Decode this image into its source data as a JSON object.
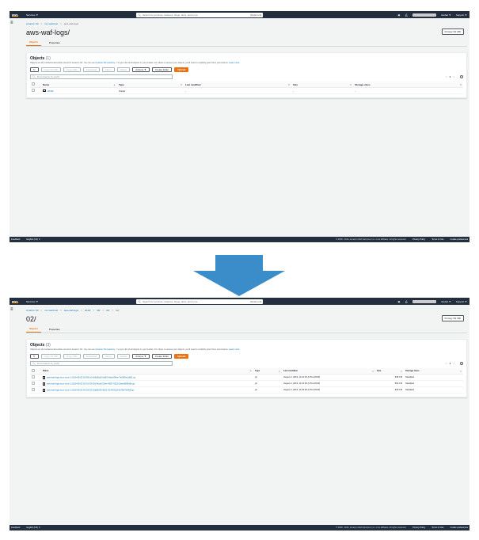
{
  "topbar": {
    "logo": "aws",
    "services": "Services ▼",
    "search_placeholder": "Search for services, features, blogs, docs, and more",
    "search_shortcut": "[Option+S]",
    "region": "Global ▼",
    "support": "Support ▼"
  },
  "footer": {
    "feedback": "Feedback",
    "language": "English (US) ▼",
    "copyright": "© 2008 - 2021, Amazon Web Services, Inc. or its affiliates. All rights reserved.",
    "privacy": "Privacy Policy",
    "terms": "Terms of Use",
    "cookies": "Cookie preferences"
  },
  "tabs": {
    "objects": "Objects",
    "properties": "Properties"
  },
  "toolbar": {
    "copy_s3_uri": "Copy S3 URI",
    "copy_url": "Copy URL",
    "download": "Download",
    "open": "Open",
    "delete": "Delete",
    "actions": "Actions ▼",
    "create_folder": "Create folder",
    "upload": "Upload"
  },
  "filter_placeholder": "Find objects by prefix",
  "pager": {
    "prev": "<",
    "page": "1",
    "next": ">"
  },
  "panel_description_prefix": "Objects are the fundamental entities stored in Amazon S3. You can use",
  "panel_description_link": "Amazon S3 inventory",
  "panel_description_suffix": "to get a list of all objects in your bucket. For others to access your objects, you'll need to explicitly grant them permissions.",
  "learn_more": "Learn more",
  "columns": {
    "name": "Name",
    "type": "Type",
    "last_modified": "Last modified",
    "size": "Size",
    "storage_class": "Storage class"
  },
  "before": {
    "breadcrumb": [
      "Amazon S3",
      "xxx-waf-host",
      "aws-waf-logs/"
    ],
    "title": "aws-waf-logs/",
    "copy_uri": "Copy S3 URI",
    "objects_header": "Objects",
    "objects_count": "(1)",
    "rows": [
      {
        "name": "2019/",
        "type": "Folder",
        "last_modified": "-",
        "size": "-",
        "storage_class": "-"
      }
    ]
  },
  "after": {
    "breadcrumb": [
      "Amazon S3",
      "xxx-waf-host",
      "aws-waf-logs/",
      "2019/",
      "08/",
      "02/",
      "02/"
    ],
    "title": "02/",
    "copy_uri": "Copy S3 URI",
    "objects_header": "Objects",
    "objects_count": "(3)",
    "rows": [
      {
        "name": "aws-waf-logs-xxxx-xxxx-1-2019-08-02-02-09-16-0b5d5ed2-bd93-4bdd-849e-7e64f5e1a891.gz",
        "type": "gz",
        "last_modified": "August 2, 2019, 11:10:15 (UTC+09:00)",
        "size": "545.0 B",
        "storage_class": "Standard"
      },
      {
        "name": "aws-waf-logs-xxxx-xxxx-1-2019-08-02-02-15-33-05134ca9-23ee-4837-9222-f0aee80f0e8b.gz",
        "type": "gz",
        "last_modified": "August 2, 2019, 11:16:36 (UTC+09:00)",
        "size": "564.0 B",
        "storage_class": "Standard"
      },
      {
        "name": "aws-waf-logs-xxxx-xxxx-1-2019-08-02-02-25-33-15a82e40-8201-4148-81af-0b75b7904bff.gz",
        "type": "gz",
        "last_modified": "August 2, 2019, 11:26:36 (UTC+09:00)",
        "size": "540.0 B",
        "storage_class": "Standard"
      }
    ]
  },
  "colors": {
    "topbar": "#232f3e",
    "link": "#0073bb",
    "accent": "#ec7211",
    "arrow": "#3a8dc9"
  }
}
